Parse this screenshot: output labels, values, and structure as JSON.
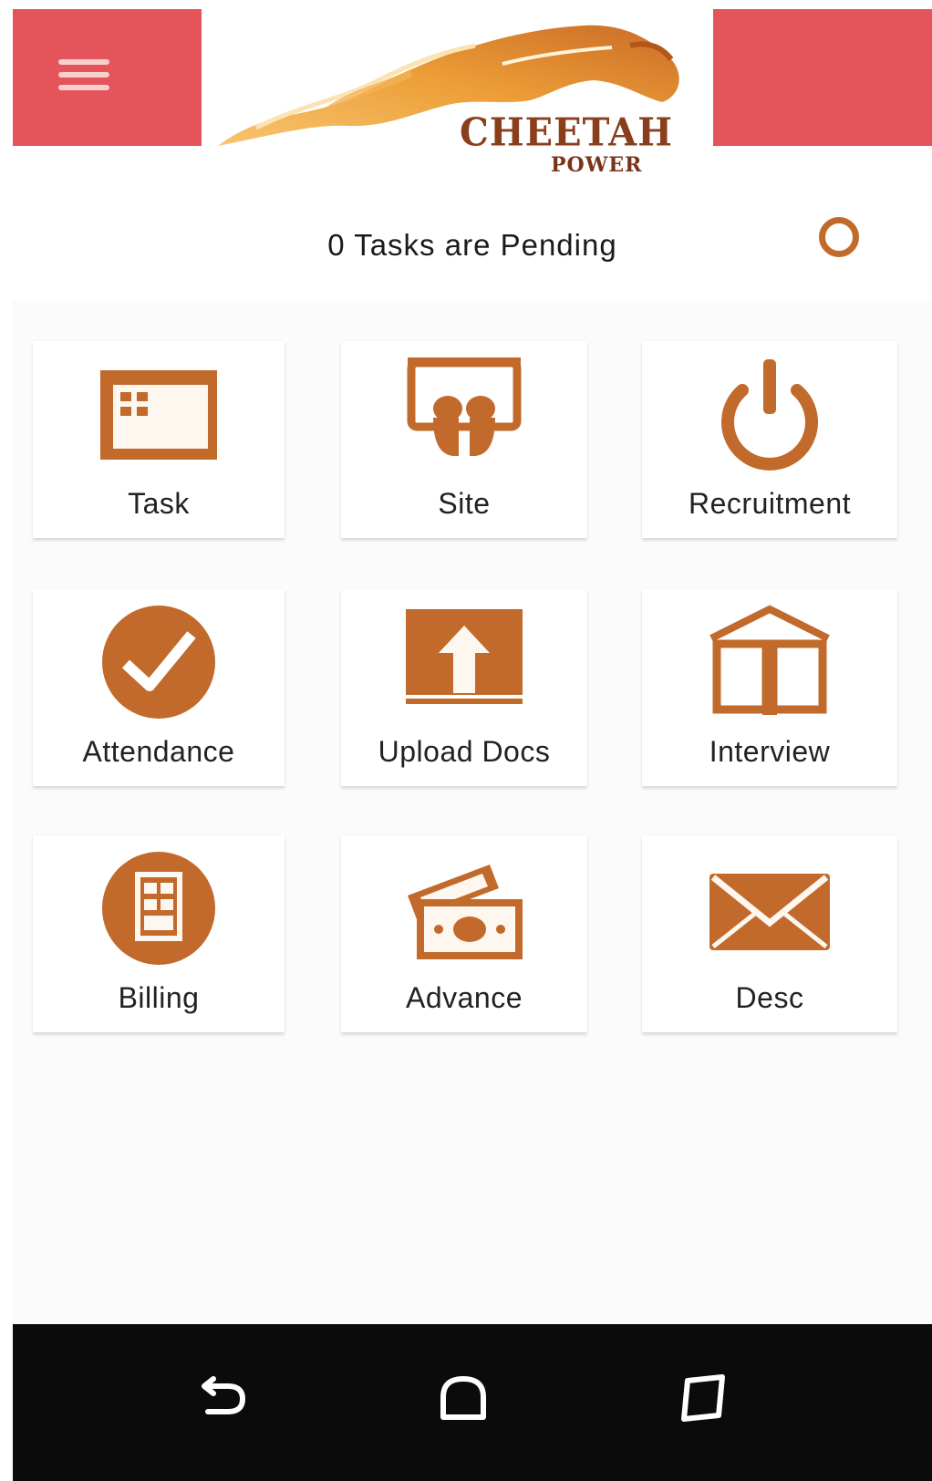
{
  "header": {
    "logo_title": "CHEETAH",
    "logo_subtitle": "POWER"
  },
  "pending": {
    "text": "0 Tasks are Pending"
  },
  "tiles": [
    {
      "label": "Task",
      "icon": "calendar-icon"
    },
    {
      "label": "Site",
      "icon": "site-icon"
    },
    {
      "label": "Recruitment",
      "icon": "power-icon"
    },
    {
      "label": "Attendance",
      "icon": "check-circle-icon"
    },
    {
      "label": "Upload Docs",
      "icon": "upload-icon"
    },
    {
      "label": "Interview",
      "icon": "book-icon"
    },
    {
      "label": "Billing",
      "icon": "billing-icon"
    },
    {
      "label": "Advance",
      "icon": "cash-icon"
    },
    {
      "label": "Desc",
      "icon": "mail-icon"
    }
  ],
  "colors": {
    "header_red": "#e4545a",
    "icon_brown": "#c26a2c",
    "navbar": "#0b0b0b"
  }
}
